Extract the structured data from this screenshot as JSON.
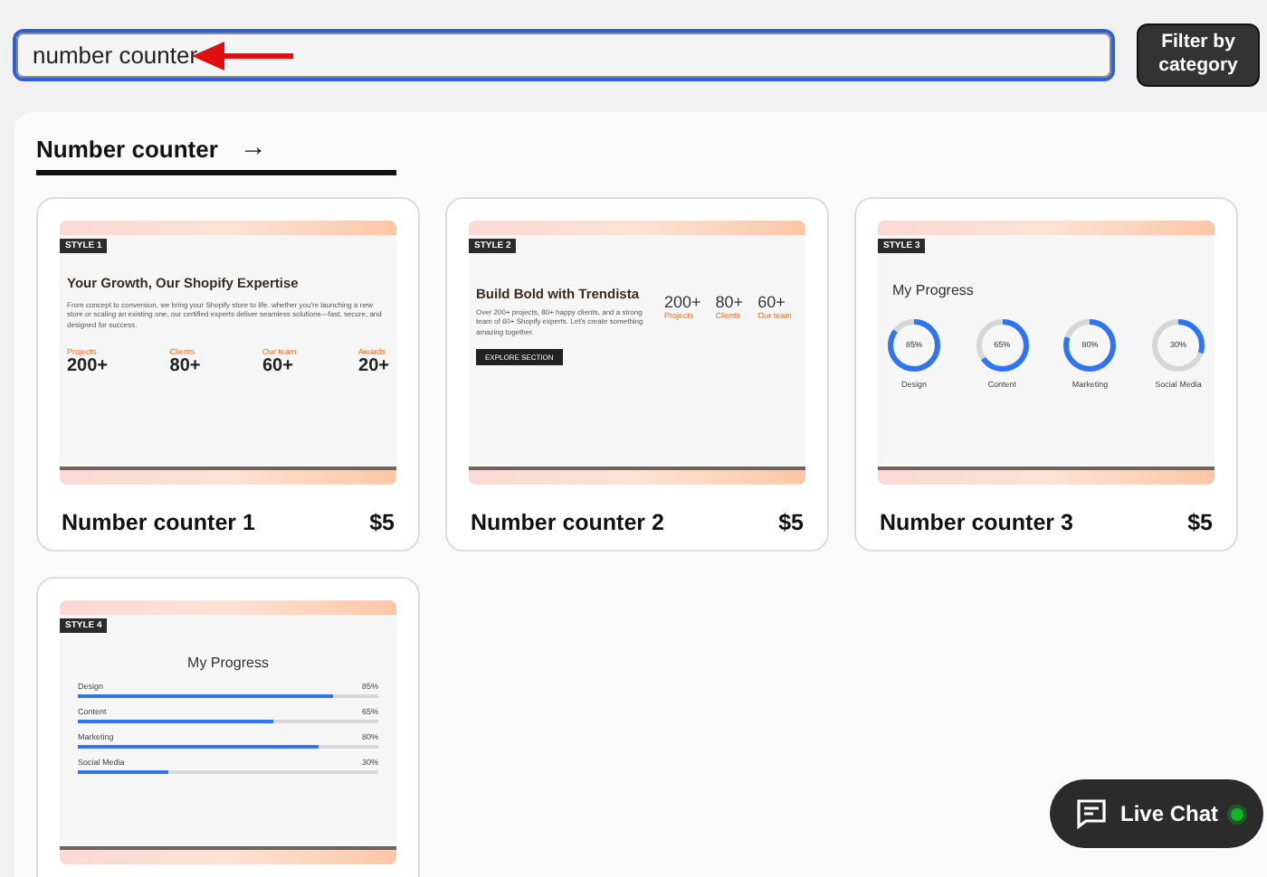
{
  "search": {
    "value": "number counter"
  },
  "filter_button": {
    "label": "Filter by\ncategory"
  },
  "section": {
    "title": "Number counter",
    "arrow": "→"
  },
  "cards": [
    {
      "kind": "intro_stats",
      "style_label": "STYLE 1",
      "name": "Number counter 1",
      "price": "$5",
      "preview": {
        "heading": "Your Growth, Our Shopify Expertise",
        "text": "From concept to conversion, we bring your Shopify store to life. whether you're launching a new store or scaling an existing one, our certified experts deliver seamless solutions—fast, secure, and designed for success.",
        "stats": [
          {
            "label": "Projects",
            "value": "200+"
          },
          {
            "label": "Clients",
            "value": "80+"
          },
          {
            "label": "Our team",
            "value": "60+"
          },
          {
            "label": "Awards",
            "value": "20+"
          }
        ]
      }
    },
    {
      "kind": "hero_stats",
      "style_label": "STYLE 2",
      "name": "Number counter 2",
      "price": "$5",
      "preview": {
        "heading": "Build Bold with Trendista",
        "text": "Over 200+ projects, 80+ happy clients, and a strong team of 60+ Shopify experts. Let's create something amazing together.",
        "button": "EXPLORE SECTION",
        "stats": [
          {
            "label": "Projects",
            "value": "200+"
          },
          {
            "label": "Clients",
            "value": "80+"
          },
          {
            "label": "Our team",
            "value": "60+"
          }
        ]
      }
    },
    {
      "kind": "progress_rings",
      "style_label": "STYLE 3",
      "name": "Number counter 3",
      "price": "$5",
      "preview": {
        "heading": "My Progress",
        "items": [
          {
            "label": "Design",
            "reading": "85%",
            "level": 0.85
          },
          {
            "label": "Content",
            "reading": "65%",
            "level": 0.65
          },
          {
            "label": "Marketing",
            "reading": "80%",
            "level": 0.8
          },
          {
            "label": "Social Media",
            "reading": "30%",
            "level": 0.3
          }
        ]
      }
    },
    {
      "kind": "progress_bars",
      "style_label": "STYLE 4",
      "preview": {
        "heading": "My Progress",
        "items": [
          {
            "label": "Design",
            "reading": "85%",
            "level": 0.85
          },
          {
            "label": "Content",
            "reading": "65%",
            "level": 0.65
          },
          {
            "label": "Marketing",
            "reading": "80%",
            "level": 0.8
          },
          {
            "label": "Social Media",
            "reading": "30%",
            "level": 0.3
          }
        ]
      }
    }
  ],
  "live_chat": {
    "label": "Live Chat",
    "online": true
  }
}
